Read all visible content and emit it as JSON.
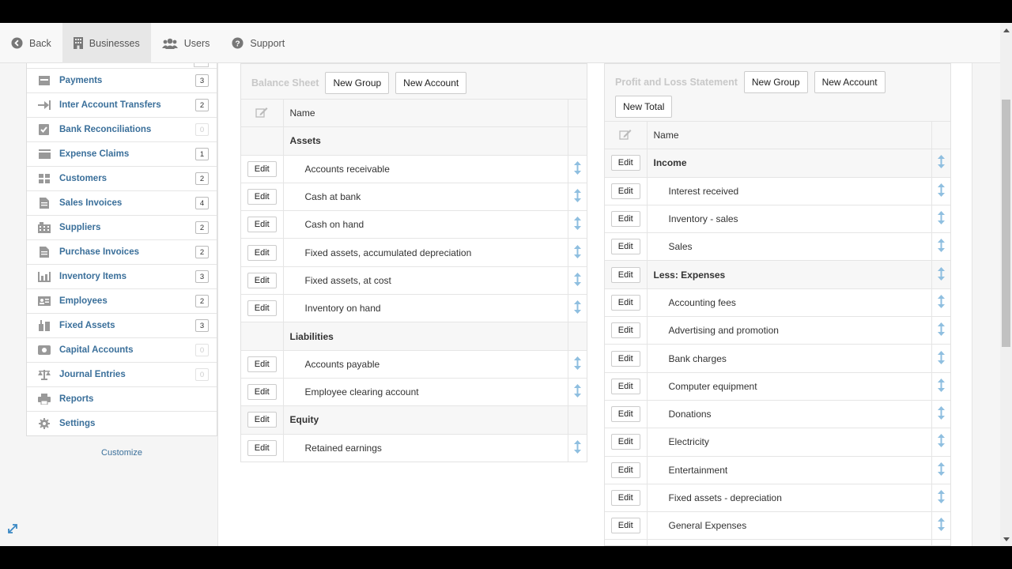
{
  "nav": {
    "back": "Back",
    "businesses": "Businesses",
    "users": "Users",
    "support": "Support"
  },
  "sidebar": {
    "items": [
      {
        "label": "Payments",
        "count": "3",
        "icon": "payments-icon"
      },
      {
        "label": "Inter Account Transfers",
        "count": "2",
        "icon": "transfer-icon"
      },
      {
        "label": "Bank Reconciliations",
        "count": "0",
        "icon": "check-square-icon"
      },
      {
        "label": "Expense Claims",
        "count": "1",
        "icon": "expense-claims-icon"
      },
      {
        "label": "Customers",
        "count": "2",
        "icon": "customers-icon"
      },
      {
        "label": "Sales Invoices",
        "count": "4",
        "icon": "document-icon"
      },
      {
        "label": "Suppliers",
        "count": "2",
        "icon": "building-icon"
      },
      {
        "label": "Purchase Invoices",
        "count": "2",
        "icon": "document-icon"
      },
      {
        "label": "Inventory Items",
        "count": "3",
        "icon": "inventory-icon"
      },
      {
        "label": "Employees",
        "count": "2",
        "icon": "id-card-icon"
      },
      {
        "label": "Fixed Assets",
        "count": "3",
        "icon": "fixed-assets-icon"
      },
      {
        "label": "Capital Accounts",
        "count": "0",
        "icon": "capital-accounts-icon"
      },
      {
        "label": "Journal Entries",
        "count": "0",
        "icon": "scales-icon"
      },
      {
        "label": "Reports",
        "count": "",
        "icon": "printer-icon"
      },
      {
        "label": "Settings",
        "count": "",
        "icon": "gear-icon"
      }
    ],
    "customize": "Customize"
  },
  "balance_sheet": {
    "title": "Balance Sheet",
    "new_group": "New Group",
    "new_account": "New Account",
    "name_header": "Name",
    "edit_label": "Edit",
    "rows": [
      {
        "type": "group",
        "name": "Assets",
        "editable": false,
        "movable": false
      },
      {
        "type": "acct",
        "name": "Accounts receivable",
        "editable": true,
        "movable": true
      },
      {
        "type": "acct",
        "name": "Cash at bank",
        "editable": true,
        "movable": true
      },
      {
        "type": "acct",
        "name": "Cash on hand",
        "editable": true,
        "movable": true
      },
      {
        "type": "acct",
        "name": "Fixed assets, accumulated depreciation",
        "editable": true,
        "movable": true
      },
      {
        "type": "acct",
        "name": "Fixed assets, at cost",
        "editable": true,
        "movable": true
      },
      {
        "type": "acct",
        "name": "Inventory on hand",
        "editable": true,
        "movable": true
      },
      {
        "type": "group",
        "name": "Liabilities",
        "editable": false,
        "movable": false
      },
      {
        "type": "acct",
        "name": "Accounts payable",
        "editable": true,
        "movable": true
      },
      {
        "type": "acct",
        "name": "Employee clearing account",
        "editable": true,
        "movable": true
      },
      {
        "type": "group",
        "name": "Equity",
        "editable": true,
        "movable": false
      },
      {
        "type": "acct",
        "name": "Retained earnings",
        "editable": true,
        "movable": true
      }
    ]
  },
  "profit_loss": {
    "title": "Profit and Loss Statement",
    "new_group": "New Group",
    "new_account": "New Account",
    "new_total": "New Total",
    "name_header": "Name",
    "edit_label": "Edit",
    "rows": [
      {
        "type": "group",
        "name": "Income",
        "editable": true,
        "movable": true
      },
      {
        "type": "acct",
        "name": "Interest received",
        "editable": true,
        "movable": true
      },
      {
        "type": "acct",
        "name": "Inventory - sales",
        "editable": true,
        "movable": true
      },
      {
        "type": "acct",
        "name": "Sales",
        "editable": true,
        "movable": true
      },
      {
        "type": "group",
        "name": "Less: Expenses",
        "editable": true,
        "movable": true
      },
      {
        "type": "acct",
        "name": "Accounting fees",
        "editable": true,
        "movable": true
      },
      {
        "type": "acct",
        "name": "Advertising and promotion",
        "editable": true,
        "movable": true
      },
      {
        "type": "acct",
        "name": "Bank charges",
        "editable": true,
        "movable": true
      },
      {
        "type": "acct",
        "name": "Computer equipment",
        "editable": true,
        "movable": true
      },
      {
        "type": "acct",
        "name": "Donations",
        "editable": true,
        "movable": true
      },
      {
        "type": "acct",
        "name": "Electricity",
        "editable": true,
        "movable": true
      },
      {
        "type": "acct",
        "name": "Entertainment",
        "editable": true,
        "movable": true
      },
      {
        "type": "acct",
        "name": "Fixed assets - depreciation",
        "editable": true,
        "movable": true
      },
      {
        "type": "acct",
        "name": "General Expenses",
        "editable": true,
        "movable": true
      },
      {
        "type": "acct",
        "name": "",
        "editable": true,
        "movable": true
      }
    ]
  },
  "colors": {
    "link": "#3a6f9a",
    "move_arrow": "#7fb3d5",
    "panel_title": "#c8c8c8"
  }
}
